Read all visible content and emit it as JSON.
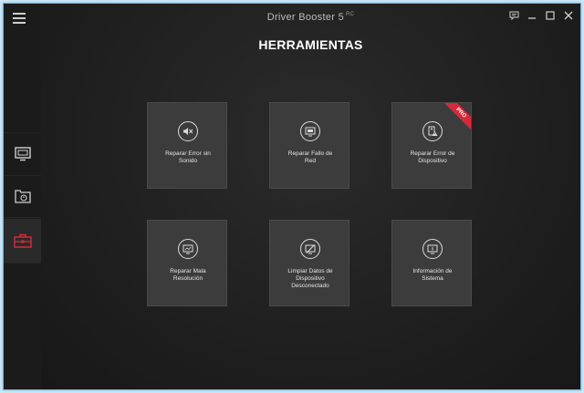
{
  "app": {
    "title": "Driver Booster 5",
    "title_badge": "RC"
  },
  "page": {
    "title": "HERRAMIENTAS"
  },
  "sidebar": {
    "items": [
      {
        "icon": "monitor-icon"
      },
      {
        "icon": "restore-icon"
      },
      {
        "icon": "toolbox-icon",
        "active": true
      }
    ]
  },
  "tools": [
    {
      "label_line1": "Reparar Error sin",
      "label_line2": "Sonido",
      "icon": "speaker-muted-icon"
    },
    {
      "label_line1": "Reparar Fallo de",
      "label_line2": "Red",
      "icon": "network-icon"
    },
    {
      "label_line1": "Reparar Error de",
      "label_line2": "Dispositivo",
      "icon": "device-warning-icon",
      "badge": "PRO"
    },
    {
      "label_line1": "Reparar Mala",
      "label_line2": "Resolución",
      "icon": "display-resolution-icon"
    },
    {
      "label_line1": "Limpiar Datos de",
      "label_line2": "Dispositivo",
      "label_line3": "Desconectado",
      "icon": "disconnected-device-icon"
    },
    {
      "label_line1": "Información de",
      "label_line2": "Sistema",
      "icon": "system-info-icon"
    }
  ],
  "colors": {
    "accent_red": "#d4293a",
    "tile_bg": "#3c3c3c",
    "background": "#1d1d1d"
  }
}
